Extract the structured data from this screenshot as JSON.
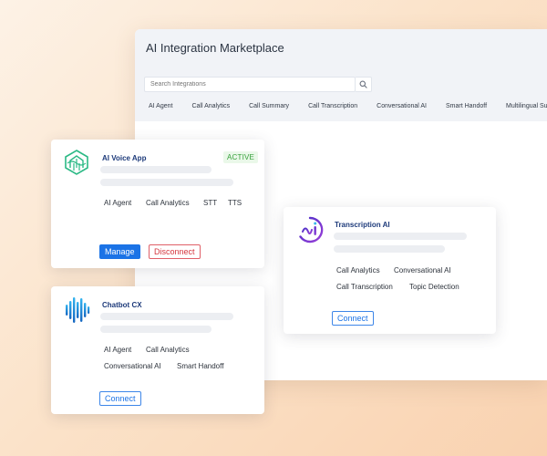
{
  "marketplace": {
    "title": "AI Integration Marketplace",
    "search": {
      "placeholder": "Search Integrations"
    },
    "categories": [
      "AI Agent",
      "Call Analytics",
      "Call Summary",
      "Call Transcription",
      "Conversational AI",
      "Smart Handoff",
      "Multilingual Support"
    ]
  },
  "cards": {
    "voice_app": {
      "title": "AI Voice App",
      "status": "ACTIVE",
      "tags": [
        "AI Agent",
        "Call Analytics",
        "STT",
        "TTS"
      ],
      "manage_label": "Manage",
      "disconnect_label": "Disconnect",
      "logo_color": "#2bb985"
    },
    "chatbot": {
      "title": "Chatbot CX",
      "tags": [
        "AI Agent",
        "Call Analytics",
        "Conversational AI",
        "Smart Handoff"
      ],
      "connect_label": "Connect",
      "logo_color": "#1e88e5"
    },
    "transcription": {
      "title": "Transcription AI",
      "tags": [
        "Call Analytics",
        "Conversational AI",
        "Call Transcription",
        "Topic Detection"
      ],
      "connect_label": "Connect",
      "logo_color": "#6c3fd6"
    }
  },
  "colors": {
    "accent": "#1b73e6",
    "danger": "#d5363e",
    "success": "#36a03a",
    "title_navy": "#1d3a7a"
  },
  "icons": {
    "search": "search-icon",
    "voice_logo": "voice-app-logo-icon",
    "chatbot_logo": "chatbot-logo-icon",
    "transcription_logo": "transcription-logo-icon"
  }
}
